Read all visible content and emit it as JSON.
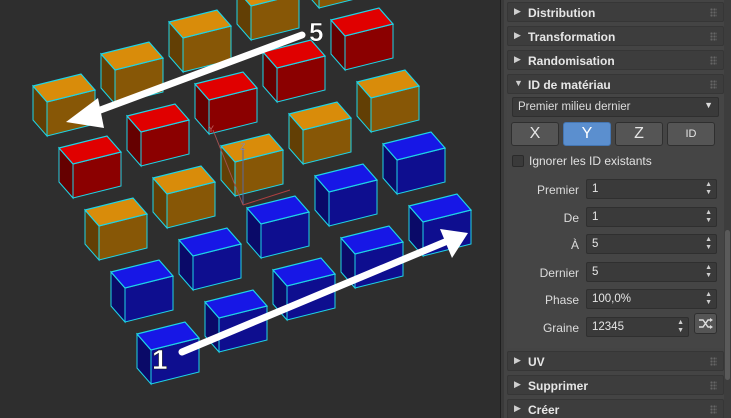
{
  "viewport": {
    "annotations": {
      "start_number": "1",
      "end_number": "5"
    },
    "gizmo_labels": {
      "y": "Y",
      "z": "Z"
    },
    "colors": {
      "red": "#e00000",
      "orange": "#d98c0a",
      "blue": "#1717e6",
      "selection": "#1ed4e6",
      "arrow": "#ffffff"
    },
    "grid_rows": [
      [
        "orange",
        "orange",
        "orange",
        "orange",
        "orange"
      ],
      [
        "red",
        "red",
        "red",
        "red",
        "red"
      ],
      [
        "orange",
        "orange",
        "orange",
        "orange",
        "orange"
      ],
      [
        "blue",
        "blue",
        "blue",
        "blue",
        "blue"
      ],
      [
        "blue",
        "blue",
        "blue",
        "blue",
        "blue"
      ]
    ]
  },
  "panel": {
    "rollouts_top": [
      {
        "label": "Distribution"
      },
      {
        "label": "Transformation"
      },
      {
        "label": "Randomisation"
      },
      {
        "label": "ID de matériau"
      }
    ],
    "material_id": {
      "mode_dropdown": "Premier milieu dernier",
      "axis_buttons": [
        {
          "label": "X",
          "active": false
        },
        {
          "label": "Y",
          "active": true
        },
        {
          "label": "Z",
          "active": false
        },
        {
          "label": "ID",
          "active": false
        }
      ],
      "ignore_checkbox_label": "Ignorer les ID existants",
      "ignore_checked": false,
      "params": [
        {
          "label": "Premier",
          "value": "1"
        },
        {
          "label": "De",
          "value": "1"
        },
        {
          "label": "À",
          "value": "5"
        },
        {
          "label": "Dernier",
          "value": "5"
        },
        {
          "label": "Phase",
          "value": "100,0%"
        },
        {
          "label": "Graine",
          "value": "12345"
        }
      ]
    },
    "rollouts_bottom": [
      {
        "label": "UV"
      },
      {
        "label": "Supprimer"
      },
      {
        "label": "Créer"
      }
    ]
  }
}
